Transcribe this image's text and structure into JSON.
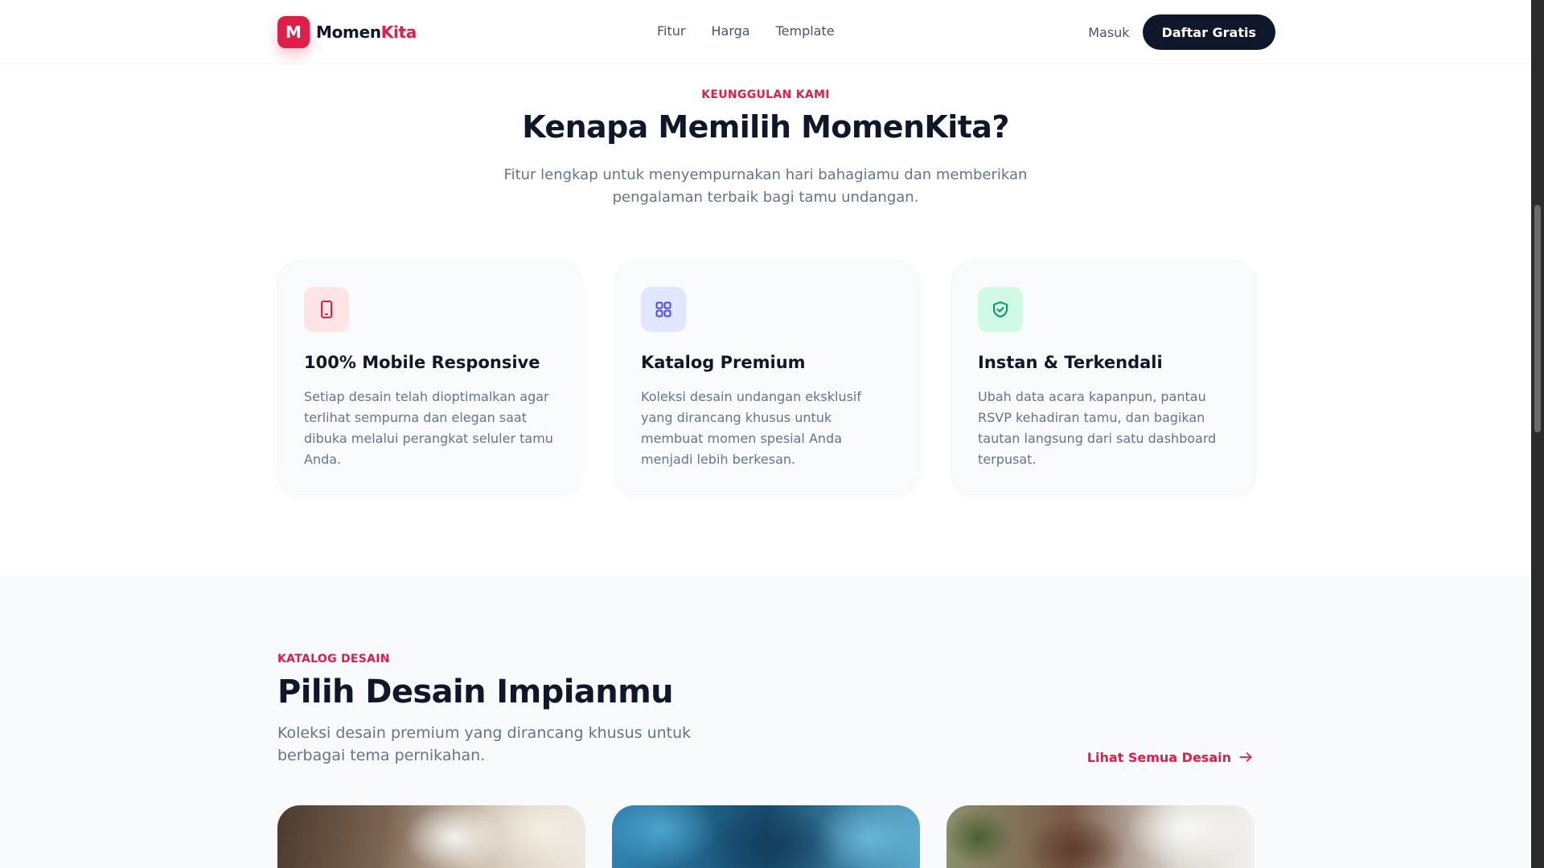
{
  "nav": {
    "logo_letter": "M",
    "brand_part1": "Momen",
    "brand_part2": "Kita",
    "links": [
      "Fitur",
      "Harga",
      "Template"
    ],
    "login": "Masuk",
    "signup": "Daftar Gratis"
  },
  "features": {
    "eyebrow": "KEUNGGULAN KAMI",
    "title": "Kenapa Memilih MomenKita?",
    "subtitle": "Fitur lengkap untuk menyempurnakan hari bahagiamu dan memberikan pengalaman terbaik bagi tamu undangan.",
    "cards": [
      {
        "icon": "smartphone-icon",
        "title": "100% Mobile Responsive",
        "desc": "Setiap desain telah dioptimalkan agar terlihat sempurna dan elegan saat dibuka melalui perangkat seluler tamu Anda."
      },
      {
        "icon": "grid-icon",
        "title": "Katalog Premium",
        "desc": "Koleksi desain undangan eksklusif yang dirancang khusus untuk membuat momen spesial Anda menjadi lebih berkesan."
      },
      {
        "icon": "shield-check-icon",
        "title": "Instan & Terkendali",
        "desc": "Ubah data acara kapanpun, pantau RSVP kehadiran tamu, dan bagikan tautan langsung dari satu dashboard terpusat."
      }
    ]
  },
  "catalog": {
    "eyebrow": "KATALOG DESAIN",
    "title": "Pilih Desain Impianmu",
    "subtitle": "Koleksi desain premium yang dirancang khusus untuk berbagai tema pernikahan.",
    "see_all": "Lihat Semua Desain",
    "see_all_icon": "arrow-right-icon"
  },
  "colors": {
    "accent": "#e11d48",
    "dark": "#0f172a",
    "muted": "#64748b",
    "indigo": "#4f46e5",
    "emerald": "#059669"
  }
}
